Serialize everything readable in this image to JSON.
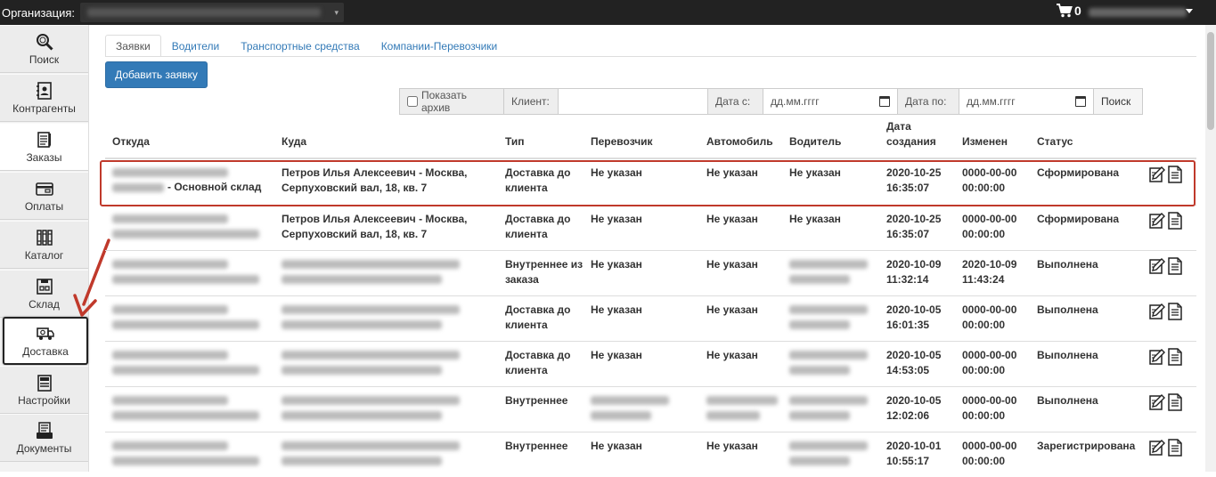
{
  "topbar": {
    "org_label": "Организация:",
    "cart_count": "0"
  },
  "sidebar": {
    "items": [
      {
        "label": "Поиск",
        "icon": "search-icon"
      },
      {
        "label": "Контрагенты",
        "icon": "contacts-icon"
      },
      {
        "label": "Заказы",
        "icon": "orders-icon"
      },
      {
        "label": "Оплаты",
        "icon": "payment-icon"
      },
      {
        "label": "Каталог",
        "icon": "catalog-icon"
      },
      {
        "label": "Склад",
        "icon": "warehouse-icon"
      },
      {
        "label": "Доставка",
        "icon": "delivery-icon"
      },
      {
        "label": "Настройки",
        "icon": "settings-icon"
      },
      {
        "label": "Документы",
        "icon": "documents-icon"
      }
    ]
  },
  "tabs": [
    "Заявки",
    "Водители",
    "Транспортные средства",
    "Компании-Перевозчики"
  ],
  "add_button": "Добавить заявку",
  "filter": {
    "archive_label": "Показать архив",
    "client_label": "Клиент:",
    "date_from_label": "Дата с:",
    "date_to_label": "Дата по:",
    "date_placeholder": "дд.мм.гггг",
    "search_button": "Поиск"
  },
  "table": {
    "headers": [
      "Откуда",
      "Куда",
      "Тип",
      "Перевозчик",
      "Автомобиль",
      "Водитель",
      "Дата создания",
      "Изменен",
      "Статус"
    ],
    "rows": [
      {
        "from": "- Основной склад",
        "to": "Петров Илья Алексеевич - Москва, Серпуховский вал, 18, кв. 7",
        "type": "Доставка до клиента",
        "carrier": "Не указан",
        "car": "Не указан",
        "driver": "Не указан",
        "created": "2020-10-25 16:35:07",
        "changed": "0000-00-00 00:00:00",
        "status": "Сформирована"
      },
      {
        "from": "",
        "to": "Петров Илья Алексеевич - Москва, Серпуховский вал, 18, кв. 7",
        "type": "Доставка до клиента",
        "carrier": "Не указан",
        "car": "Не указан",
        "driver": "Не указан",
        "created": "2020-10-25 16:35:07",
        "changed": "0000-00-00 00:00:00",
        "status": "Сформирована"
      },
      {
        "from": "",
        "to": "",
        "type": "Внутреннее из заказа",
        "carrier": "Не указан",
        "car": "Не указан",
        "driver": "",
        "created": "2020-10-09 11:32:14",
        "changed": "2020-10-09 11:43:24",
        "status": "Выполнена"
      },
      {
        "from": "",
        "to": "",
        "type": "Доставка до клиента",
        "carrier": "Не указан",
        "car": "Не указан",
        "driver": "",
        "created": "2020-10-05 16:01:35",
        "changed": "0000-00-00 00:00:00",
        "status": "Выполнена"
      },
      {
        "from": "",
        "to": "",
        "type": "Доставка до клиента",
        "carrier": "Не указан",
        "car": "Не указан",
        "driver": "",
        "created": "2020-10-05 14:53:05",
        "changed": "0000-00-00 00:00:00",
        "status": "Выполнена"
      },
      {
        "from": "",
        "to": "",
        "type": "Внутреннее",
        "carrier": "",
        "car": "",
        "driver": "",
        "created": "2020-10-05 12:02:06",
        "changed": "0000-00-00 00:00:00",
        "status": "Выполнена"
      },
      {
        "from": "",
        "to": "",
        "type": "Внутреннее",
        "carrier": "Не указан",
        "car": "Не указан",
        "driver": "",
        "created": "2020-10-01 10:55:17",
        "changed": "0000-00-00 00:00:00",
        "status": "Зарегистрирована"
      }
    ]
  },
  "colors": {
    "topbar": "#222222",
    "primary_button": "#337ab7",
    "selection_outline": "#c0392b",
    "arrow": "#c0392b"
  }
}
